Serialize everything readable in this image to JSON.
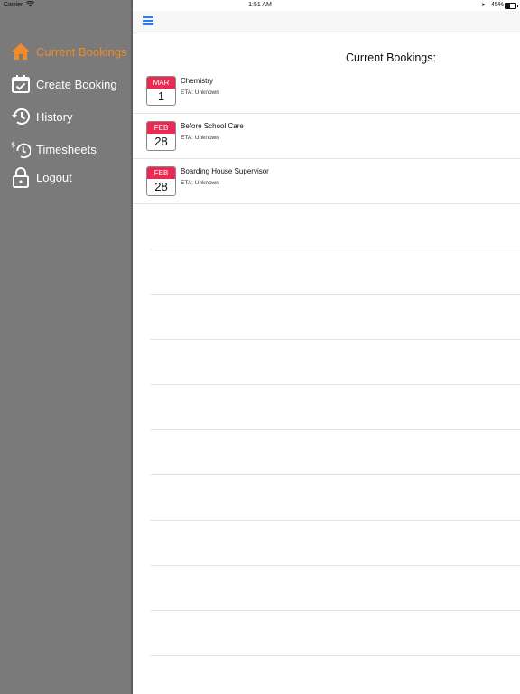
{
  "status_bar": {
    "carrier": "Carrier",
    "time": "1:51 AM",
    "battery": "45%"
  },
  "sidebar": {
    "items": [
      {
        "label": "Current Bookings",
        "icon": "home-icon",
        "active": true
      },
      {
        "label": "Create Booking",
        "icon": "calendar-check-icon",
        "active": false
      },
      {
        "label": "History",
        "icon": "history-icon",
        "active": false
      },
      {
        "label": "Timesheets",
        "icon": "timesheet-icon",
        "active": false
      },
      {
        "label": "Logout",
        "icon": "lock-icon",
        "active": false
      }
    ]
  },
  "main": {
    "heading": "Current Bookings:",
    "bookings": [
      {
        "month": "MAR",
        "day": "1",
        "title": "Chemistry",
        "eta": "ETA: Unknown"
      },
      {
        "month": "FEB",
        "day": "28",
        "title": "Before School Care",
        "eta": "ETA: Unknown"
      },
      {
        "month": "FEB",
        "day": "28",
        "title": "Boarding House Supervisor",
        "eta": "ETA: Unknown"
      }
    ]
  },
  "colors": {
    "accent": "#f08a2a",
    "calendar_header": "#ea2a50",
    "sidebar_bg": "#7a7a7a",
    "nav_icon": "#2b7de9"
  }
}
